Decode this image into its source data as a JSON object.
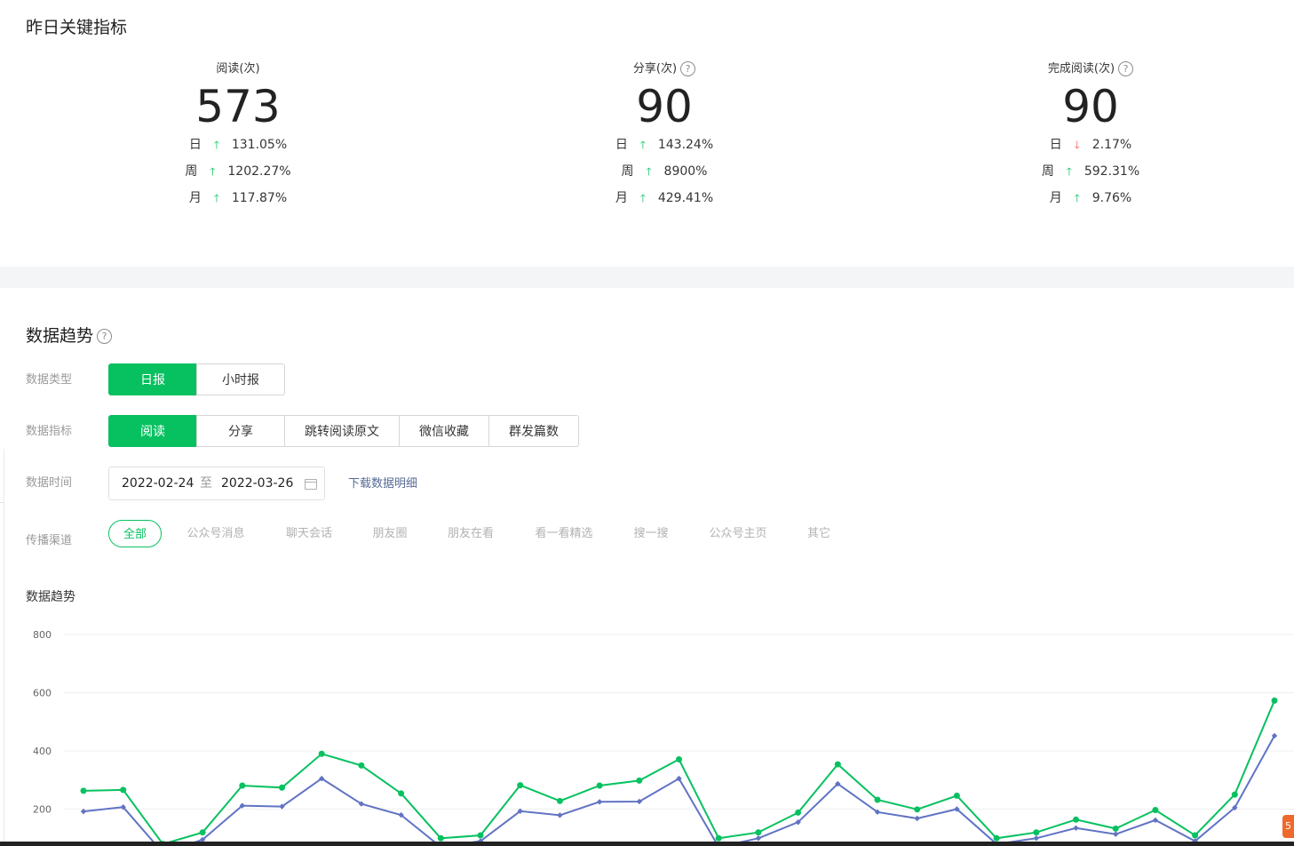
{
  "key_metrics": {
    "title": "昨日关键指标",
    "items": [
      {
        "label": "阅读(次)",
        "help": false,
        "value": "573",
        "rows": [
          {
            "k": "日",
            "dir": "up",
            "v": "131.05%"
          },
          {
            "k": "周",
            "dir": "up",
            "v": "1202.27%"
          },
          {
            "k": "月",
            "dir": "up",
            "v": "117.87%"
          }
        ]
      },
      {
        "label": "分享(次)",
        "help": true,
        "value": "90",
        "rows": [
          {
            "k": "日",
            "dir": "up",
            "v": "143.24%"
          },
          {
            "k": "周",
            "dir": "up",
            "v": "8900%"
          },
          {
            "k": "月",
            "dir": "up",
            "v": "429.41%"
          }
        ]
      },
      {
        "label": "完成阅读(次)",
        "help": true,
        "value": "90",
        "rows": [
          {
            "k": "日",
            "dir": "down",
            "v": "2.17%"
          },
          {
            "k": "周",
            "dir": "up",
            "v": "592.31%"
          },
          {
            "k": "月",
            "dir": "up",
            "v": "9.76%"
          }
        ]
      }
    ]
  },
  "trend": {
    "title": "数据趋势",
    "help_glyph": "?",
    "type_label": "数据类型",
    "type_options": [
      "日报",
      "小时报"
    ],
    "type_selected": 0,
    "metric_label": "数据指标",
    "metric_options": [
      "阅读",
      "分享",
      "跳转阅读原文",
      "微信收藏",
      "群发篇数"
    ],
    "metric_selected": 0,
    "time_label": "数据时间",
    "date_from": "2022-02-24",
    "date_sep": "至",
    "date_to": "2022-03-26",
    "download_link": "下载数据明细",
    "channel_label": "传播渠道",
    "channels": [
      "全部",
      "公众号消息",
      "聊天会话",
      "朋友圈",
      "朋友在看",
      "看一看精选",
      "搜一搜",
      "公众号主页",
      "其它"
    ],
    "channel_selected": 0,
    "chart_title": "数据趋势"
  },
  "colors": {
    "accent": "#07c160",
    "series_1": "#07c160",
    "series_2": "#6173c4",
    "up": "#07c160",
    "down": "#fa5151",
    "link": "#576b95"
  },
  "chart_data": {
    "type": "line",
    "title": "数据趋势",
    "xlabel": "",
    "ylabel": "",
    "ylim": [
      0,
      800
    ],
    "yticks": [
      200,
      400,
      600,
      800
    ],
    "grid": true,
    "legend": "none",
    "x": [
      1,
      2,
      3,
      4,
      5,
      6,
      7,
      8,
      9,
      10,
      11,
      12,
      13,
      14,
      15,
      16,
      17,
      18,
      19,
      20,
      21,
      22,
      23,
      24,
      25,
      26,
      27,
      28,
      29,
      30,
      31
    ],
    "series": [
      {
        "color": "#07c160",
        "marker": "circle",
        "values": [
          263,
          266,
          80,
          120,
          281,
          274,
          390,
          350,
          254,
          100,
          110,
          282,
          228,
          281,
          298,
          371,
          100,
          120,
          188,
          354,
          232,
          199,
          246,
          100,
          120,
          164,
          133,
          197,
          110,
          250,
          573
        ]
      },
      {
        "color": "#6173c4",
        "marker": "diamond",
        "values": [
          192,
          207,
          50,
          95,
          212,
          209,
          305,
          218,
          180,
          70,
          90,
          193,
          179,
          225,
          226,
          305,
          70,
          100,
          155,
          287,
          190,
          168,
          200,
          80,
          100,
          135,
          114,
          162,
          90,
          205,
          452
        ]
      }
    ]
  }
}
